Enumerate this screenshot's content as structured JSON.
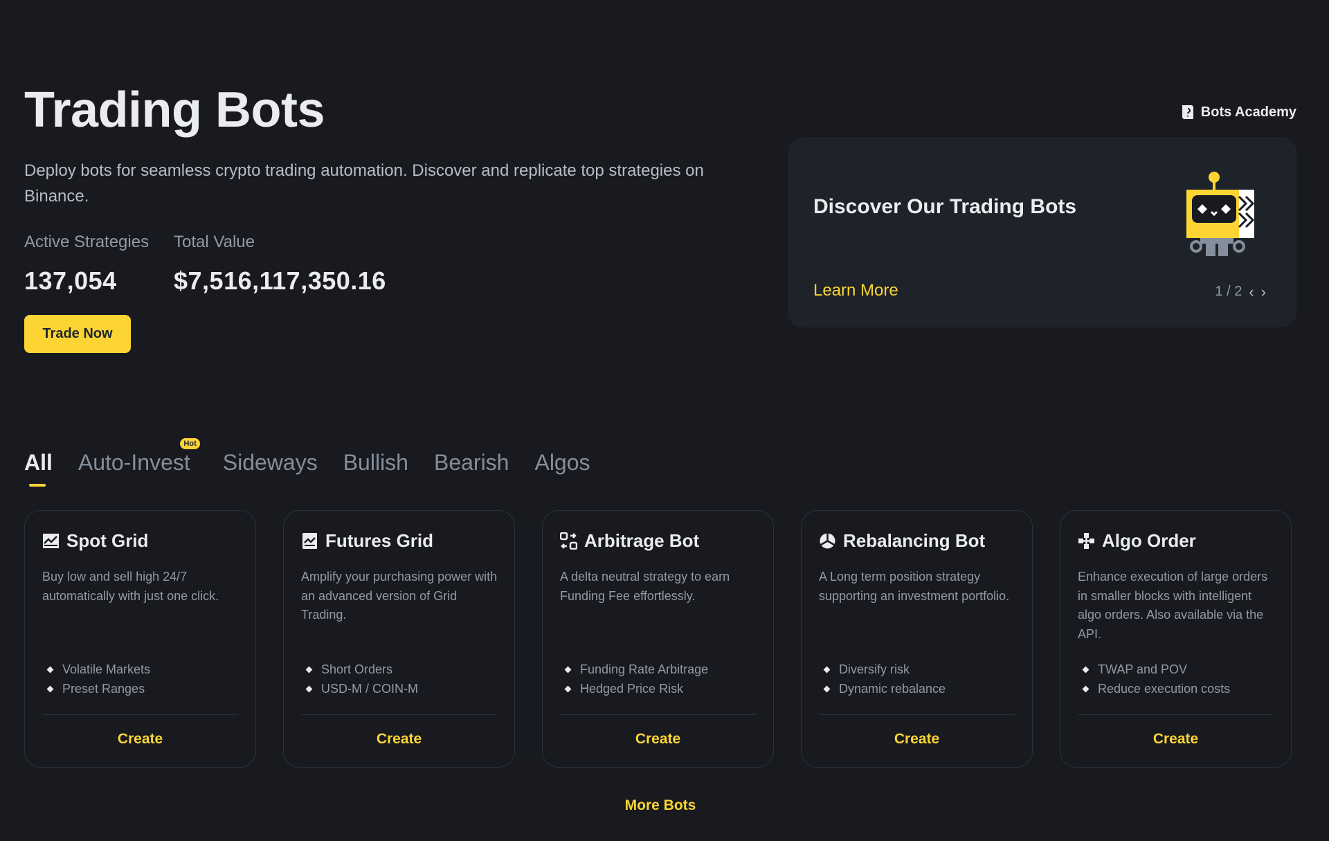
{
  "header": {
    "title": "Trading Bots",
    "subtitle": "Deploy bots for seamless crypto trading automation. Discover and replicate top strategies on Binance.",
    "stats": [
      {
        "label": "Active Strategies",
        "value": "137,054"
      },
      {
        "label": "Total Value",
        "value": "$7,516,117,350.16"
      }
    ],
    "cta_label": "Trade Now"
  },
  "academy": {
    "label": "Bots Academy",
    "icon": "book-icon"
  },
  "promo": {
    "title": "Discover Our Trading Bots",
    "link": "Learn More",
    "pager": "1 / 2",
    "prev": "‹",
    "next": "›"
  },
  "tabs": [
    {
      "label": "All",
      "active": true
    },
    {
      "label": "Auto-Invest",
      "badge": "Hot"
    },
    {
      "label": "Sideways"
    },
    {
      "label": "Bullish"
    },
    {
      "label": "Bearish"
    },
    {
      "label": "Algos"
    }
  ],
  "cards": [
    {
      "title": "Spot Grid",
      "icon": "chart-icon",
      "desc": "Buy low and sell high 24/7 automatically with just one click.",
      "bullets": [
        "Volatile Markets",
        "Preset Ranges"
      ],
      "action": "Create"
    },
    {
      "title": "Futures Grid",
      "icon": "futures-chart-icon",
      "desc": "Amplify your purchasing power with an advanced version of Grid Trading.",
      "bullets": [
        "Short Orders",
        "USD-M / COIN-M"
      ],
      "action": "Create"
    },
    {
      "title": "Arbitrage Bot",
      "icon": "arbitrage-icon",
      "desc": "A delta neutral strategy to earn Funding Fee effortlessly.",
      "bullets": [
        "Funding Rate Arbitrage",
        "Hedged Price Risk"
      ],
      "action": "Create"
    },
    {
      "title": "Rebalancing Bot",
      "icon": "pie-icon",
      "desc": "A Long term position strategy supporting an investment portfolio.",
      "bullets": [
        "Diversify risk",
        "Dynamic rebalance"
      ],
      "action": "Create"
    },
    {
      "title": "Algo Order",
      "icon": "algo-icon",
      "desc": "Enhance execution of large orders in smaller blocks with intelligent algo orders. Also available via the API.",
      "bullets": [
        "TWAP and POV",
        "Reduce execution costs"
      ],
      "action": "Create"
    }
  ],
  "more_label": "More Bots",
  "colors": {
    "accent": "#fcd535",
    "background": "#181a20",
    "card": "#1e2329"
  }
}
